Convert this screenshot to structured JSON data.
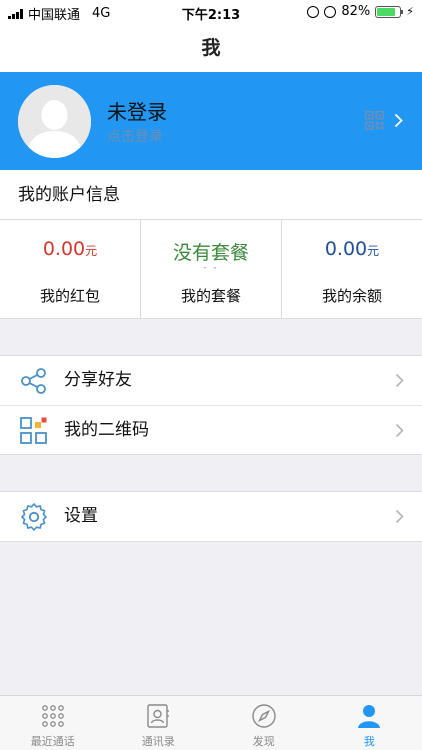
{
  "status_bar": {
    "carrier": "中国联通",
    "network": "4G",
    "time": "下午2:13",
    "battery": "82%",
    "battery_level": 0.82
  },
  "nav": {
    "title": "我"
  },
  "profile": {
    "name": "未登录",
    "subtitle": "点击登录",
    "qr_icon": "qr-code-icon",
    "chevron_icon": "chevron-right-icon"
  },
  "account": {
    "header": "我的账户信息",
    "items": [
      {
        "value": "0.00",
        "unit": "元",
        "label": "我的红包",
        "color": "#d0392b"
      },
      {
        "value": "没有套餐",
        "sub": "- -",
        "label": "我的套餐",
        "color": "#3b8a3b"
      },
      {
        "value": "0.00",
        "unit": "元",
        "label": "我的余额",
        "color": "#1f4e9a"
      }
    ]
  },
  "menu": {
    "group1": [
      {
        "label": "分享好友",
        "icon": "share-icon"
      },
      {
        "label": "我的二维码",
        "icon": "qr-grid-icon"
      }
    ],
    "group2": [
      {
        "label": "设置",
        "icon": "gear-icon"
      }
    ]
  },
  "tabs": [
    {
      "label": "最近通话",
      "icon": "dialpad-icon",
      "active": false
    },
    {
      "label": "通讯录",
      "icon": "contacts-icon",
      "active": false
    },
    {
      "label": "发现",
      "icon": "compass-icon",
      "active": false
    },
    {
      "label": "我",
      "icon": "person-icon",
      "active": true
    }
  ],
  "colors": {
    "accent": "#2196f3",
    "icon_blue": "#4a90c8",
    "tab_inactive": "#8a8a8a"
  }
}
